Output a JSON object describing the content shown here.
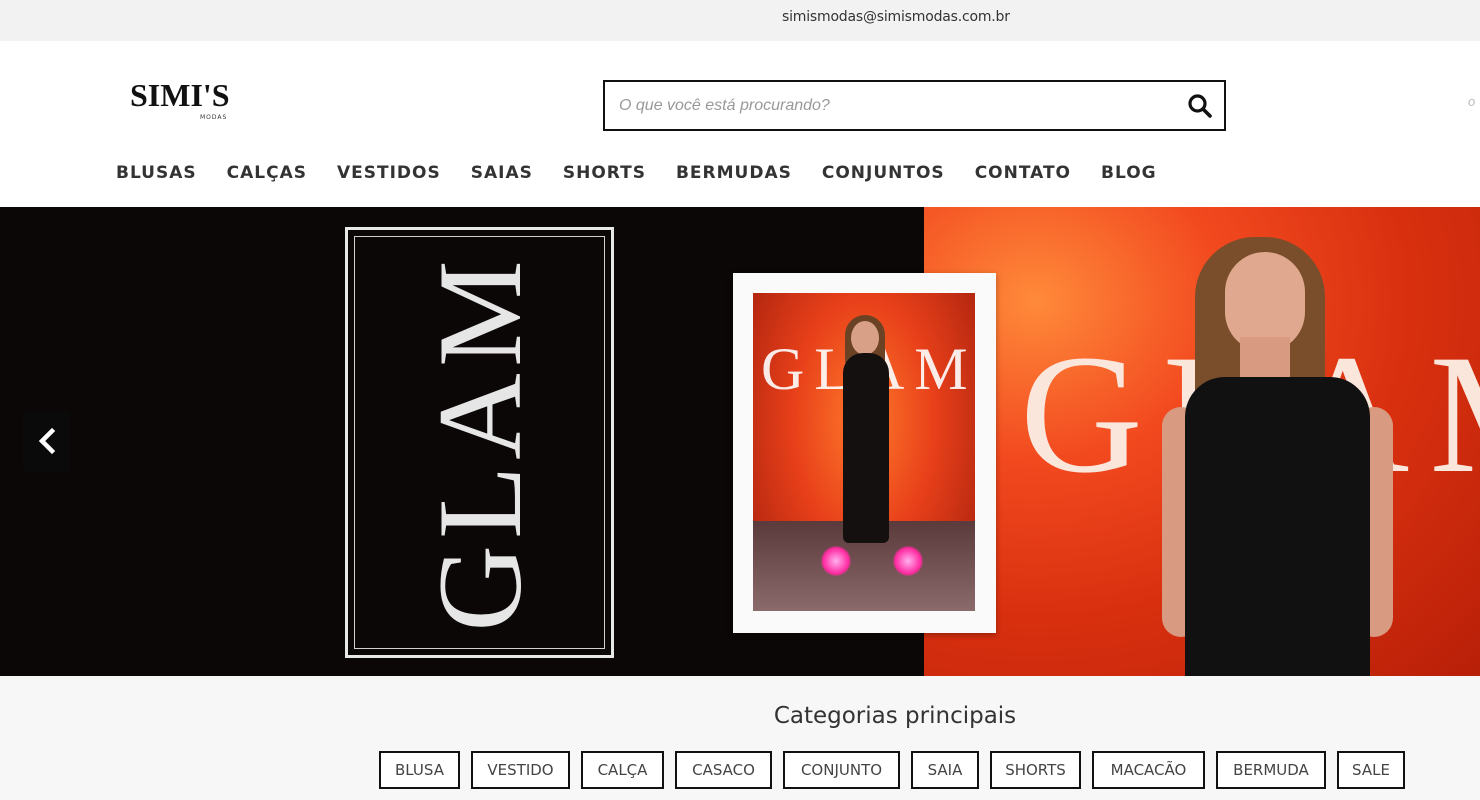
{
  "topbar": {
    "email": "simismodas@simismodas.com.br"
  },
  "header": {
    "logo": {
      "main": "SIMI'S",
      "sub": "MODAS"
    },
    "search": {
      "placeholder": "O que você está procurando?",
      "value": ""
    },
    "edge_text": "o"
  },
  "nav": {
    "items": [
      {
        "label": "BLUSAS"
      },
      {
        "label": "CALÇAS"
      },
      {
        "label": "VESTIDOS"
      },
      {
        "label": "SAIAS"
      },
      {
        "label": "SHORTS"
      },
      {
        "label": "BERMUDAS"
      },
      {
        "label": "CONJUNTOS"
      },
      {
        "label": "CONTATO"
      },
      {
        "label": "BLOG"
      }
    ]
  },
  "hero": {
    "vertical_text": "GLAM",
    "photo_text": "GLAM",
    "big_text": "GLAM"
  },
  "categories": {
    "title": "Categorias principais",
    "items": [
      {
        "label": "BLUSA"
      },
      {
        "label": "VESTIDO"
      },
      {
        "label": "CALÇA"
      },
      {
        "label": "CASACO"
      },
      {
        "label": "CONJUNTO"
      },
      {
        "label": "SAIA"
      },
      {
        "label": "SHORTS"
      },
      {
        "label": "MACACÃO"
      },
      {
        "label": "BERMUDA"
      },
      {
        "label": "SALE"
      }
    ]
  },
  "icons": {
    "search": "search-icon",
    "prev": "chevron-left-icon"
  }
}
